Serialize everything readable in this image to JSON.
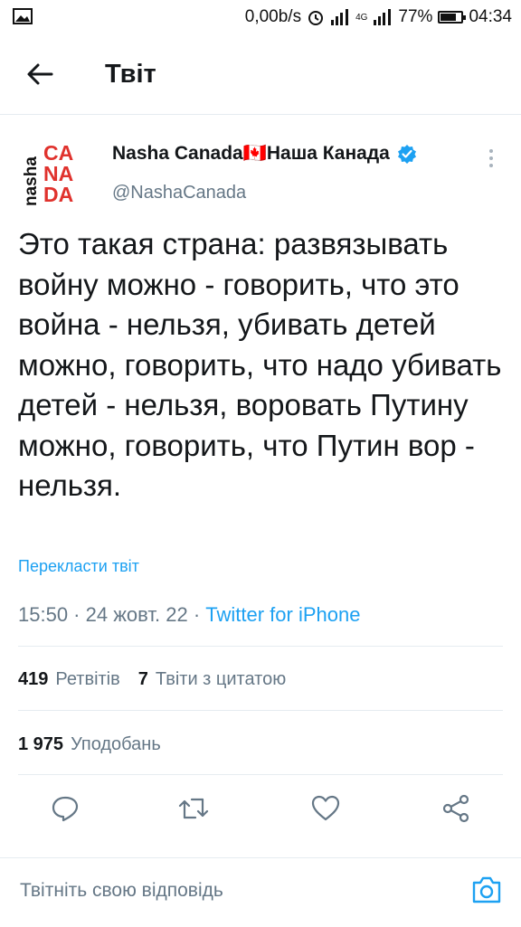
{
  "status_bar": {
    "net_speed": "0,00b/s",
    "network": "4G",
    "battery": "77%",
    "battery_level": 0.77,
    "time": "04:34"
  },
  "header": {
    "title": "Твіт"
  },
  "tweet": {
    "author_name": "Nasha Canada🇨🇦Наша Канада",
    "author_handle": "@NashaCanada",
    "avatar_letters": [
      "nasha",
      "CA",
      "NA",
      "DA"
    ],
    "text": "Это такая страна: развязывать войну можно - говорить, что это война - нельзя, убивать детей можно, говорить, что надо убивать детей - нельзя, воровать Путину можно, говорить, что Путин вор - нельзя.",
    "translate_label": "Перекласти твіт",
    "time": "15:50",
    "date": "24 жовт. 22",
    "source": "Twitter for iPhone",
    "retweets_count": "419",
    "retweets_label": "Ретвітів",
    "quotes_count": "7",
    "quotes_label": "Твіти з цитатою",
    "likes_count": "1 975",
    "likes_label": "Уподобань"
  },
  "reply": {
    "placeholder": "Твітніть свою відповідь"
  },
  "colors": {
    "accent": "#1da1f2",
    "brand_red": "#e0322d",
    "secondary_text": "#657786"
  }
}
